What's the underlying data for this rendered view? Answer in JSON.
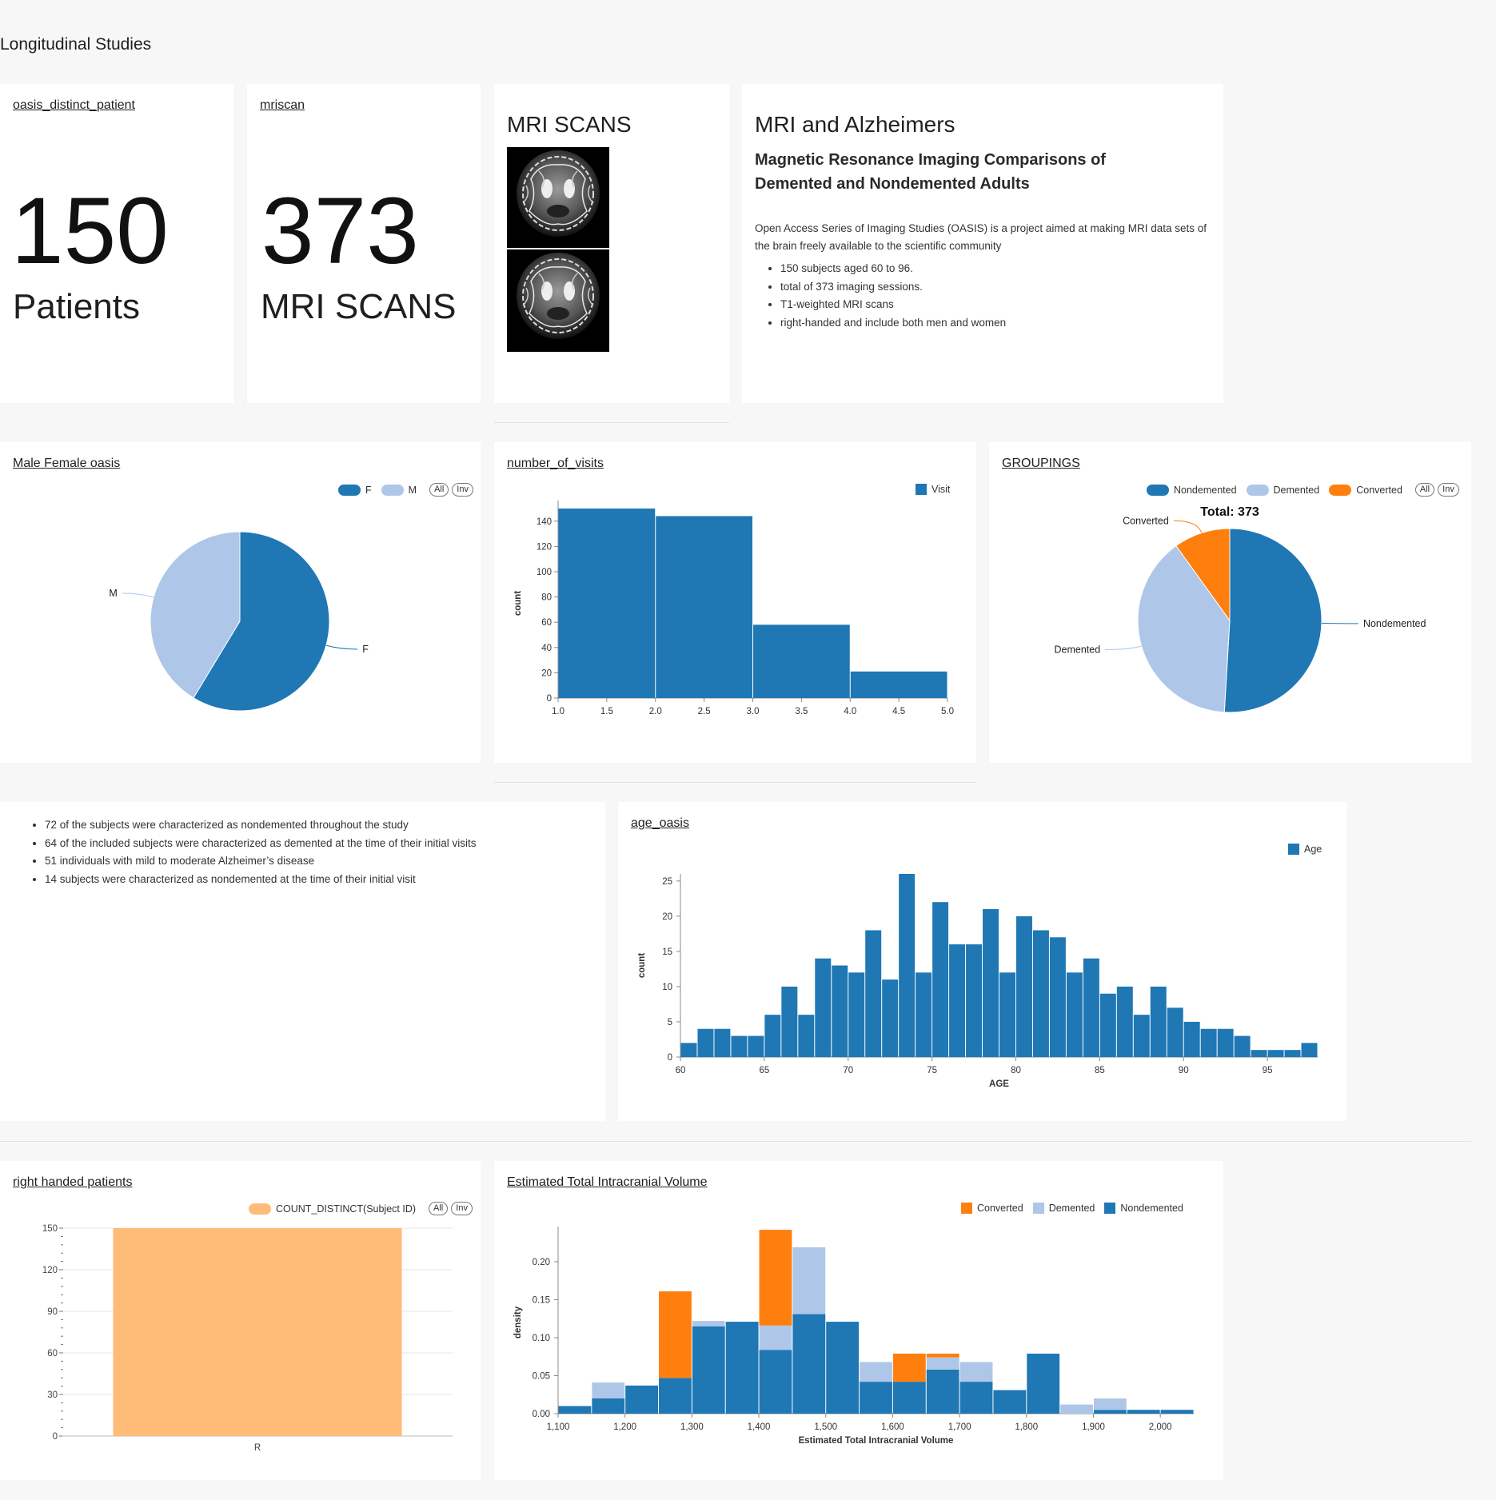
{
  "dashboard_title": "Longitudinal Studies",
  "colors": {
    "blue": "#1f77b4",
    "light_blue": "#aec7e8",
    "orange": "#ff7f0e",
    "peach": "#ffbb78"
  },
  "kpi_patients": {
    "title": "oasis_distinct_patient",
    "value": "150",
    "subtitle": "Patients"
  },
  "kpi_scans": {
    "title": "mriscan",
    "value": "373",
    "subtitle": "MRI SCANS"
  },
  "mri_card": {
    "heading": "MRI SCANS",
    "image_icon": "brain-mri-image"
  },
  "info_card": {
    "heading": "MRI and Alzheimers",
    "subheading": "Magnetic Resonance Imaging Comparisons of Demented and Nondemented Adults",
    "paragraph": "Open Access Series of Imaging Studies (OASIS) is a project aimed at making MRI data sets of the brain freely available to the scientific community",
    "bullets": [
      "150 subjects aged 60 to 96.",
      "total of 373 imaging sessions.",
      "T1-weighted MRI scans",
      "right-handed and include both men and women"
    ]
  },
  "notes_card": {
    "bullets": [
      "72 of the subjects were characterized as nondemented throughout the study",
      "64 of the included subjects were characterized as demented at the time of their initial visits",
      "51 individuals with mild to moderate Alzheimer’s disease",
      "14 subjects were characterized as nondemented at the time of their initial visit"
    ]
  },
  "legend_buttons": {
    "all": "All",
    "inv": "Inv"
  },
  "gender_chart": {
    "title": "Male Female oasis",
    "legend": [
      "F",
      "M"
    ],
    "chart_data": {
      "type": "pie",
      "slices": [
        {
          "label": "F",
          "value": 88
        },
        {
          "label": "M",
          "value": 62
        }
      ]
    }
  },
  "visits_chart": {
    "title": "number_of_visits",
    "legend": "Visit",
    "chart_data": {
      "type": "bar",
      "bins": [
        [
          1,
          2
        ],
        [
          2,
          3
        ],
        [
          3,
          4
        ],
        [
          4,
          5
        ]
      ],
      "values": [
        150,
        144,
        58,
        21
      ],
      "xlim": [
        1,
        5
      ],
      "ylim": [
        0,
        150
      ],
      "x_ticks": [
        "1.0",
        "1.5",
        "2.0",
        "2.5",
        "3.0",
        "3.5",
        "4.0",
        "4.5",
        "5.0"
      ],
      "y_ticks": [
        "0",
        "20",
        "40",
        "60",
        "80",
        "100",
        "120",
        "140"
      ],
      "ylabel": "count"
    }
  },
  "groupings_chart": {
    "title": "GROUPINGS",
    "legend": [
      "Nondemented",
      "Demented",
      "Converted"
    ],
    "total_label": "Total: 373",
    "chart_data": {
      "type": "pie",
      "slices": [
        {
          "label": "Nondemented",
          "value": 190
        },
        {
          "label": "Demented",
          "value": 146
        },
        {
          "label": "Converted",
          "value": 37
        }
      ]
    }
  },
  "age_chart": {
    "title": "age_oasis",
    "legend": "Age",
    "chart_data": {
      "type": "bar",
      "bin_start": 60,
      "bin_width": 1,
      "values": [
        2,
        4,
        4,
        3,
        3,
        6,
        10,
        6,
        14,
        13,
        12,
        18,
        11,
        26,
        12,
        22,
        16,
        16,
        21,
        12,
        20,
        18,
        17,
        12,
        14,
        9,
        10,
        6,
        10,
        7,
        5,
        4,
        4,
        3,
        1,
        1,
        1,
        2
      ],
      "xlim": [
        60,
        98
      ],
      "ylim": [
        0,
        26
      ],
      "x_ticks": [
        "60",
        "65",
        "70",
        "75",
        "80",
        "85",
        "90",
        "95"
      ],
      "y_ticks": [
        "0",
        "5",
        "10",
        "15",
        "20",
        "25"
      ],
      "xlabel": "AGE",
      "ylabel": "count"
    }
  },
  "handed_chart": {
    "title": "right handed patients",
    "legend": "COUNT_DISTINCT(Subject ID)",
    "chart_data": {
      "type": "bar",
      "categories": [
        "R"
      ],
      "values": [
        150
      ],
      "ylim": [
        0,
        150
      ],
      "y_ticks": [
        "0",
        "30",
        "60",
        "90",
        "120",
        "150"
      ]
    }
  },
  "etiv_chart": {
    "title": "Estimated Total Intracranial Volume",
    "legend": [
      "Converted",
      "Demented",
      "Nondemented"
    ],
    "chart_data": {
      "type": "bar",
      "stacked": true,
      "bin_start": 1100,
      "bin_width": 50,
      "series": [
        {
          "name": "Nondemented",
          "values": [
            0.01,
            0.02,
            0.037,
            0.047,
            0.115,
            0.121,
            0.084,
            0.131,
            0.121,
            0.042,
            0.042,
            0.058,
            0.042,
            0.031,
            0.079,
            0,
            0.005,
            0.005,
            0.005
          ]
        },
        {
          "name": "Demented",
          "values": [
            0,
            0.021,
            0,
            0,
            0.007,
            0,
            0.032,
            0.088,
            0,
            0.026,
            0,
            0.016,
            0.026,
            0,
            0,
            0.012,
            0.015,
            0,
            0
          ]
        },
        {
          "name": "Converted",
          "values": [
            0,
            0,
            0,
            0.114,
            0,
            0,
            0.126,
            0,
            0,
            0,
            0.037,
            0.005,
            0,
            0,
            0,
            0,
            0,
            0,
            0
          ]
        }
      ],
      "xlim": [
        1100,
        2050
      ],
      "ylim": [
        0,
        0.24
      ],
      "x_ticks": [
        "1,100",
        "1,200",
        "1,300",
        "1,400",
        "1,500",
        "1,600",
        "1,700",
        "1,800",
        "1,900",
        "2,000"
      ],
      "y_ticks": [
        "0.00",
        "0.05",
        "0.10",
        "0.15",
        "0.20"
      ],
      "xlabel": "Estimated Total Intracranial Volume",
      "ylabel": "density"
    }
  }
}
